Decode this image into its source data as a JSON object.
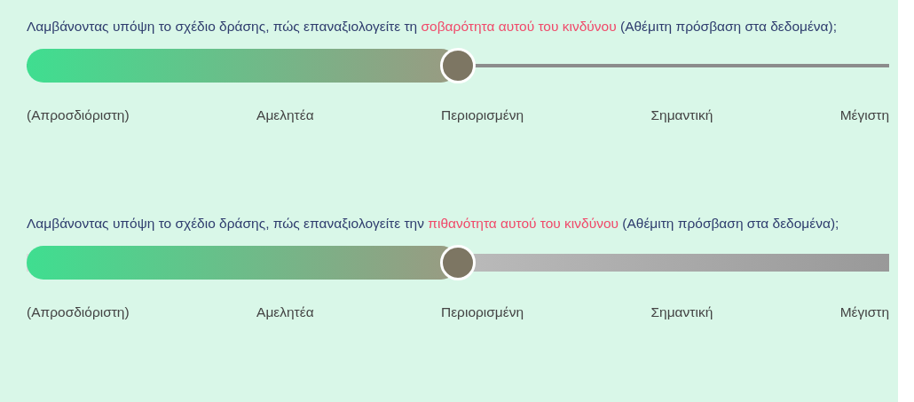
{
  "questions": [
    {
      "text": [
        {
          "t": "Λαμβάνοντας υπόψη το σχέδιο δράσης, πώς επαναξιολογείτε τη ",
          "emphasis": false
        },
        {
          "t": "σοβαρότητα αυτού του κινδύνου",
          "emphasis": true
        },
        {
          "t": " (Αθέμιτη πρόσβαση στα δεδομένα);",
          "emphasis": false
        }
      ],
      "slider": {
        "kind": "thin",
        "level": 0.5
      },
      "scale": [
        "(Απροσδιόριστη)",
        "Αμελητέα",
        "Περιορισμένη",
        "Σημαντική",
        "Μέγιστη"
      ]
    },
    {
      "text": [
        {
          "t": "Λαμβάνοντας υπόψη το σχέδιο δράσης, πώς επαναξιολογείτε την ",
          "emphasis": false
        },
        {
          "t": "πιθανότητα αυτού του κινδύνου",
          "emphasis": true
        },
        {
          "t": " (Αθέμιτη πρόσβαση στα δεδομένα);",
          "emphasis": false
        }
      ],
      "slider": {
        "kind": "thick",
        "level": 0.5
      },
      "scale": [
        "(Απροσδιόριστη)",
        "Αμελητέα",
        "Περιορισμένη",
        "Σημαντική",
        "Μέγιστη"
      ]
    }
  ]
}
